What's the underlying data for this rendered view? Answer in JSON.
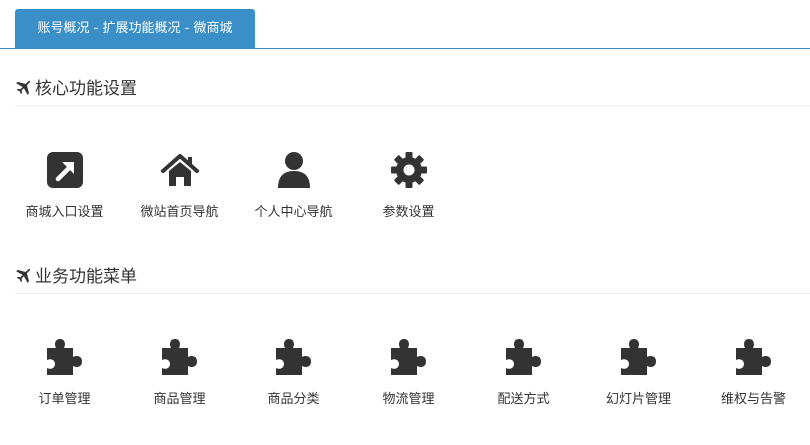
{
  "tabs": [
    {
      "label": "账号概况 - 扩展功能概况 - 微商城"
    }
  ],
  "sections": [
    {
      "title": "核心功能设置",
      "items": [
        {
          "label": "商城入口设置",
          "icon": "external-link-square-icon"
        },
        {
          "label": "微站首页导航",
          "icon": "home-icon"
        },
        {
          "label": "个人中心导航",
          "icon": "user-icon"
        },
        {
          "label": "参数设置",
          "icon": "gear-icon"
        }
      ]
    },
    {
      "title": "业务功能菜单",
      "items": [
        {
          "label": "订单管理",
          "icon": "puzzle-piece-icon"
        },
        {
          "label": "商品管理",
          "icon": "puzzle-piece-icon"
        },
        {
          "label": "商品分类",
          "icon": "puzzle-piece-icon"
        },
        {
          "label": "物流管理",
          "icon": "puzzle-piece-icon"
        },
        {
          "label": "配送方式",
          "icon": "puzzle-piece-icon"
        },
        {
          "label": "幻灯片管理",
          "icon": "puzzle-piece-icon"
        },
        {
          "label": "维权与告警",
          "icon": "puzzle-piece-icon"
        }
      ]
    }
  ],
  "colors": {
    "accent": "#3a8fc8",
    "icon": "#333333",
    "text": "#333333"
  }
}
